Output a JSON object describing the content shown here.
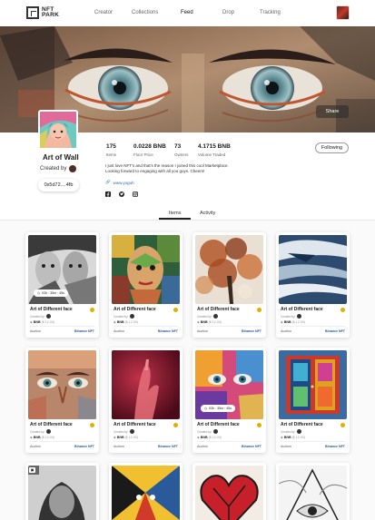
{
  "header": {
    "logo_line1": "NFT",
    "logo_line2": "PARK",
    "nav": [
      {
        "label": "Creator"
      },
      {
        "label": "Collections"
      },
      {
        "label": "Feed"
      },
      {
        "label": "Drop"
      },
      {
        "label": "Tracking"
      }
    ],
    "active_nav": "Feed"
  },
  "banner": {
    "share_label": "Share"
  },
  "profile": {
    "name": "Art of Wall",
    "created_by": "Created by",
    "address": "0x5d72....4fb",
    "follow_label": "Following",
    "stats": [
      {
        "value": "175",
        "label": "Items"
      },
      {
        "value": "0.0228 BNB",
        "label": "Floor Price"
      },
      {
        "value": "73",
        "label": "Owners"
      },
      {
        "value": "4.1715 BNB",
        "label": "Volume Traded"
      }
    ],
    "bio": "I just love NFT's and that's the reason I joined this cool Marketplace. Looking forward to engaging with all you guys. Cheers!",
    "link": "www.yoguh",
    "socials": [
      "facebook-icon",
      "twitter-icon",
      "instagram-icon"
    ]
  },
  "tabs": [
    {
      "label": "Items"
    },
    {
      "label": "Activity"
    }
  ],
  "active_tab": "Items",
  "cards": [
    {
      "title": "Art of Different face",
      "creator": "Created by",
      "price": "BNB",
      "price_usd": "($ 12.00)",
      "sale": "Auction",
      "chain": "Binance NFT",
      "timer": "03h : 35m : 45s"
    },
    {
      "title": "Art of Different face",
      "creator": "Created by",
      "price": "BNB",
      "price_usd": "($ 12.00)",
      "sale": "Auction",
      "chain": "Binance NFT",
      "timer": ""
    },
    {
      "title": "Art of Different face",
      "creator": "Created by",
      "price": "BNB",
      "price_usd": "($ 12.00)",
      "sale": "Auction",
      "chain": "Binance NFT",
      "timer": ""
    },
    {
      "title": "Art of Different face",
      "creator": "Created by",
      "price": "BNB",
      "price_usd": "($ 12.00)",
      "sale": "Auction",
      "chain": "Binance NFT",
      "timer": ""
    },
    {
      "title": "Art of Different face",
      "creator": "Created by",
      "price": "BNB",
      "price_usd": "($ 12.00)",
      "sale": "Auction",
      "chain": "Binance NFT",
      "timer": ""
    },
    {
      "title": "Art of Different face",
      "creator": "Created by",
      "price": "BNB",
      "price_usd": "($ 12.00)",
      "sale": "Auction",
      "chain": "Binance NFT",
      "timer": ""
    },
    {
      "title": "Art of Different face",
      "creator": "Created by",
      "price": "BNB",
      "price_usd": "($ 12.00)",
      "sale": "Auction",
      "chain": "Binance NFT",
      "timer": "03h : 35m : 45s"
    },
    {
      "title": "Art of Different face",
      "creator": "Created by",
      "price": "BNB",
      "price_usd": "($ 12.00)",
      "sale": "Auction",
      "chain": "Binance NFT",
      "timer": ""
    }
  ],
  "colors": {
    "accent": "#2255aa",
    "coin": "#e0b000",
    "text": "#1a1a1a"
  }
}
